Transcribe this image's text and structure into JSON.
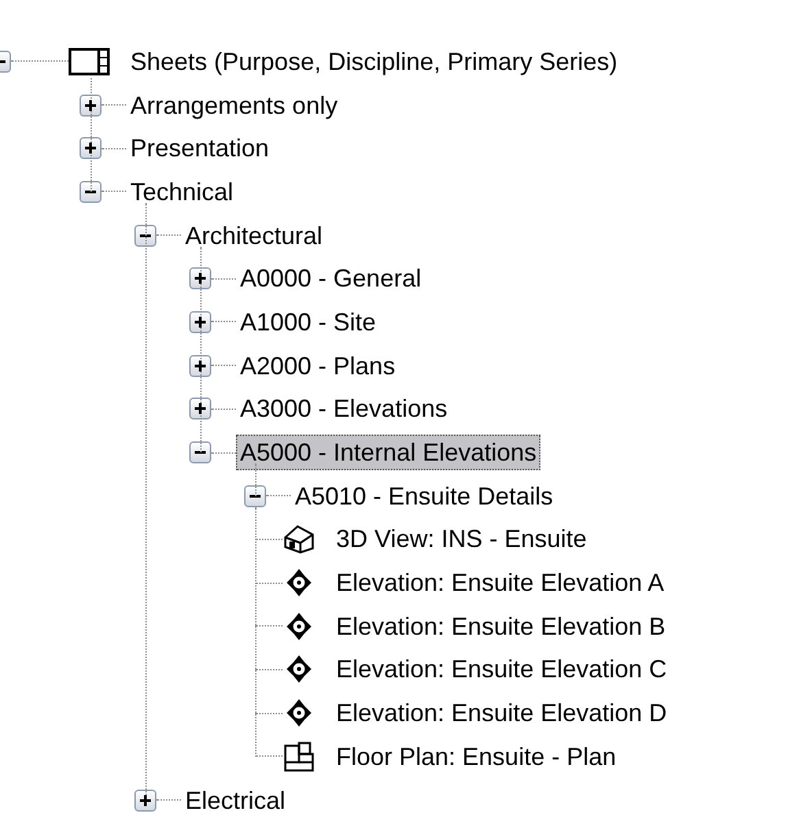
{
  "tree": [
    {
      "label": "Sheets (Purpose, Discipline, Primary Series)",
      "kind": "sheets",
      "expanded": true,
      "selected": false,
      "children": [
        {
          "label": "Arrangements only",
          "expanded": false,
          "selected": false
        },
        {
          "label": "Presentation",
          "expanded": false,
          "selected": false
        },
        {
          "label": "Technical",
          "expanded": true,
          "selected": false,
          "children": [
            {
              "label": "Architectural",
              "expanded": true,
              "selected": false,
              "children": [
                {
                  "label": "A0000 - General",
                  "expanded": false,
                  "selected": false
                },
                {
                  "label": "A1000 - Site",
                  "expanded": false,
                  "selected": false
                },
                {
                  "label": "A2000 - Plans",
                  "expanded": false,
                  "selected": false
                },
                {
                  "label": "A3000 - Elevations",
                  "expanded": false,
                  "selected": false
                },
                {
                  "label": "A5000 - Internal Elevations",
                  "expanded": true,
                  "selected": true,
                  "children": [
                    {
                      "label": "A5010 - Ensuite Details",
                      "expanded": true,
                      "selected": false,
                      "children": [
                        {
                          "label": "3D View: INS - Ensuite",
                          "kind": "perspective",
                          "selected": false
                        },
                        {
                          "label": "Elevation: Ensuite Elevation A",
                          "kind": "elevation",
                          "selected": false
                        },
                        {
                          "label": "Elevation: Ensuite Elevation B",
                          "kind": "elevation",
                          "selected": false
                        },
                        {
                          "label": "Elevation: Ensuite Elevation C",
                          "kind": "elevation",
                          "selected": false
                        },
                        {
                          "label": "Elevation: Ensuite Elevation D",
                          "kind": "elevation",
                          "selected": false
                        },
                        {
                          "label": "Floor Plan: Ensuite - Plan",
                          "kind": "floorplan",
                          "selected": false
                        }
                      ]
                    }
                  ]
                }
              ]
            },
            {
              "label": "Electrical",
              "expanded": false,
              "selected": false
            }
          ]
        }
      ]
    }
  ]
}
